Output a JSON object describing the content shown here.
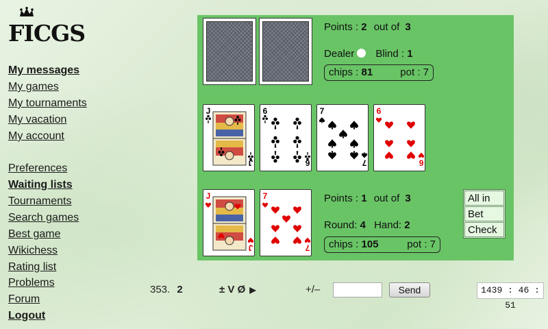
{
  "logo": {
    "text": "FICGS"
  },
  "nav": [
    {
      "label": "My messages",
      "bold": true
    },
    {
      "label": "My games",
      "bold": false
    },
    {
      "label": "My tournaments",
      "bold": false
    },
    {
      "label": "My vacation",
      "bold": false
    },
    {
      "label": "My account",
      "bold": false
    },
    {
      "label": "Preferences",
      "bold": false
    },
    {
      "label": "Waiting lists",
      "bold": true
    },
    {
      "label": "Tournaments",
      "bold": false
    },
    {
      "label": "Search games",
      "bold": false
    },
    {
      "label": "Best game",
      "bold": false
    },
    {
      "label": "Wikichess",
      "bold": false
    },
    {
      "label": "Rating list",
      "bold": false
    },
    {
      "label": "Problems",
      "bold": false
    },
    {
      "label": "Forum",
      "bold": false
    },
    {
      "label": "Logout",
      "bold": true
    }
  ],
  "opponent": {
    "points_label": "Points :",
    "points": "2",
    "out_of_label": "out of",
    "out_of": "3",
    "dealer_label": "Dealer",
    "blind_label": "Blind :",
    "blind": "1",
    "chips_label": "chips :",
    "chips": "81",
    "pot_label": "pot : 7"
  },
  "board_cards": [
    {
      "rank": "J",
      "suit": "clubs",
      "color": "#000000"
    },
    {
      "rank": "6",
      "suit": "clubs",
      "color": "#000000"
    },
    {
      "rank": "7",
      "suit": "spades",
      "color": "#000000"
    },
    {
      "rank": "6",
      "suit": "hearts",
      "color": "#e00000"
    }
  ],
  "player_cards": [
    {
      "rank": "J",
      "suit": "hearts",
      "color": "#e00000"
    },
    {
      "rank": "7",
      "suit": "hearts",
      "color": "#e00000"
    }
  ],
  "player": {
    "points_label": "Points :",
    "points": "1",
    "out_of_label": "out of",
    "out_of": "3",
    "round_label": "Round:",
    "round": "4",
    "hand_label": "Hand:",
    "hand": "2",
    "chips_label": "chips :",
    "chips": "105",
    "pot_label": "pot : 7"
  },
  "actions": [
    "All in",
    "Bet",
    "Check"
  ],
  "bottom": {
    "move_number": "353.",
    "move_value": "2",
    "symbols": "± V Ø",
    "plus_minus": "+/–",
    "send_label": "Send",
    "clock": "1439 : 46 : 51"
  },
  "colors": {
    "table": "#69c466",
    "red_suit": "#e00000",
    "black_suit": "#000000"
  }
}
